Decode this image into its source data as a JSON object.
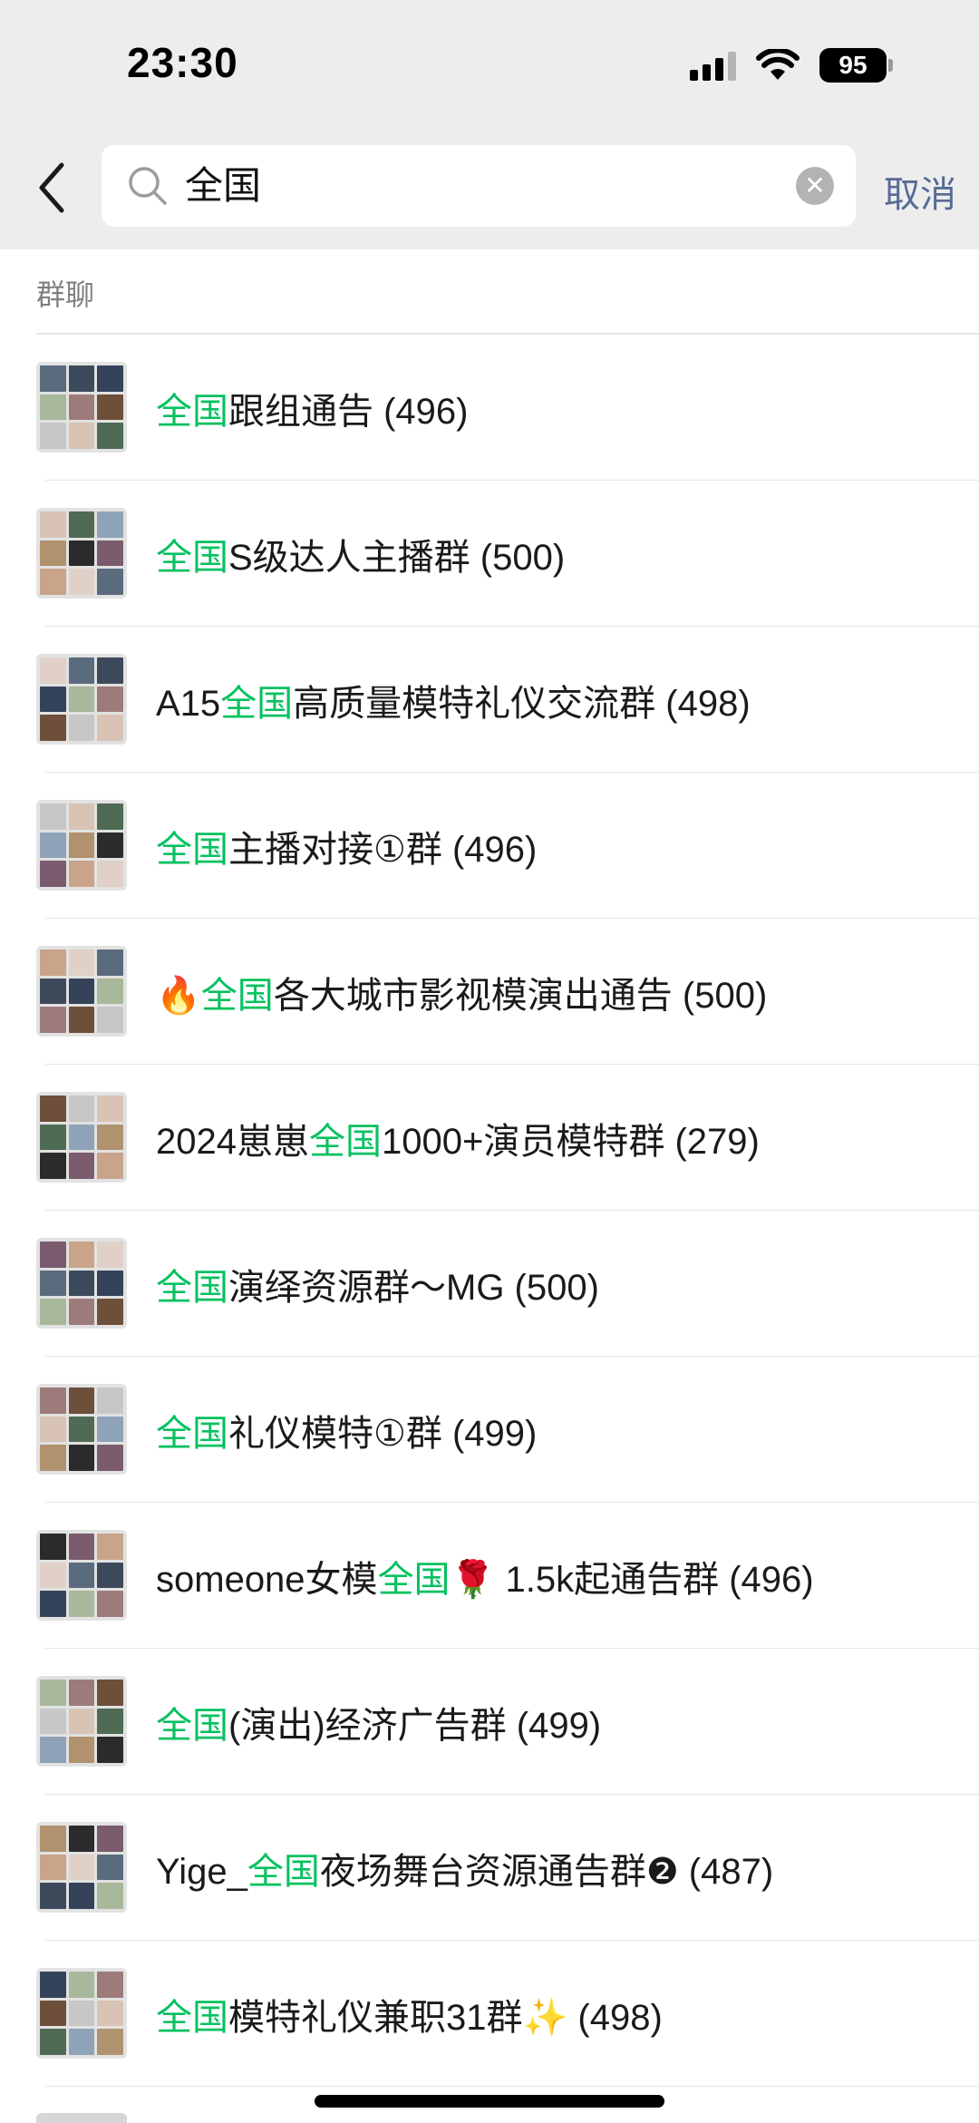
{
  "status_bar": {
    "time": "23:30",
    "battery": "95"
  },
  "search": {
    "query": "全国",
    "cancel_label": "取消"
  },
  "section": {
    "title": "群聊"
  },
  "results": [
    {
      "pre": "",
      "hl": "全国",
      "post": "跟组通告 (496)"
    },
    {
      "pre": "",
      "hl": "全国",
      "post": "S级达人主播群 (500)"
    },
    {
      "pre": "A15",
      "hl": "全国",
      "post": "高质量模特礼仪交流群 (498)"
    },
    {
      "pre": "",
      "hl": "全国",
      "post": "主播对接①群 (496)"
    },
    {
      "pre": "🔥",
      "hl": "全国",
      "post": "各大城市影视模演出通告 (500)"
    },
    {
      "pre": "2024崽崽",
      "hl": "全国",
      "post": "1000+演员模特群 (279)"
    },
    {
      "pre": "",
      "hl": "全国",
      "post": "演绎资源群～MG (500)"
    },
    {
      "pre": "",
      "hl": "全国",
      "post": "礼仪模特①群 (499)"
    },
    {
      "pre": "someone女模",
      "hl": "全国",
      "post": "🌹 1.5k起通告群 (496)"
    },
    {
      "pre": "",
      "hl": "全国",
      "post": "(演出)经济广告群 (499)"
    },
    {
      "pre": "Yige_",
      "hl": "全国",
      "post": "夜场舞台资源通告群❷ (487)"
    },
    {
      "pre": "",
      "hl": "全国",
      "post": "模特礼仪兼职31群✨ (498)"
    }
  ],
  "colors": {
    "highlight": "#07c160",
    "cancel": "#576b95",
    "header_bg": "#ededed"
  },
  "icons": [
    "back-chevron-icon",
    "search-icon",
    "clear-icon",
    "signal-icon",
    "wifi-icon",
    "battery-icon"
  ]
}
